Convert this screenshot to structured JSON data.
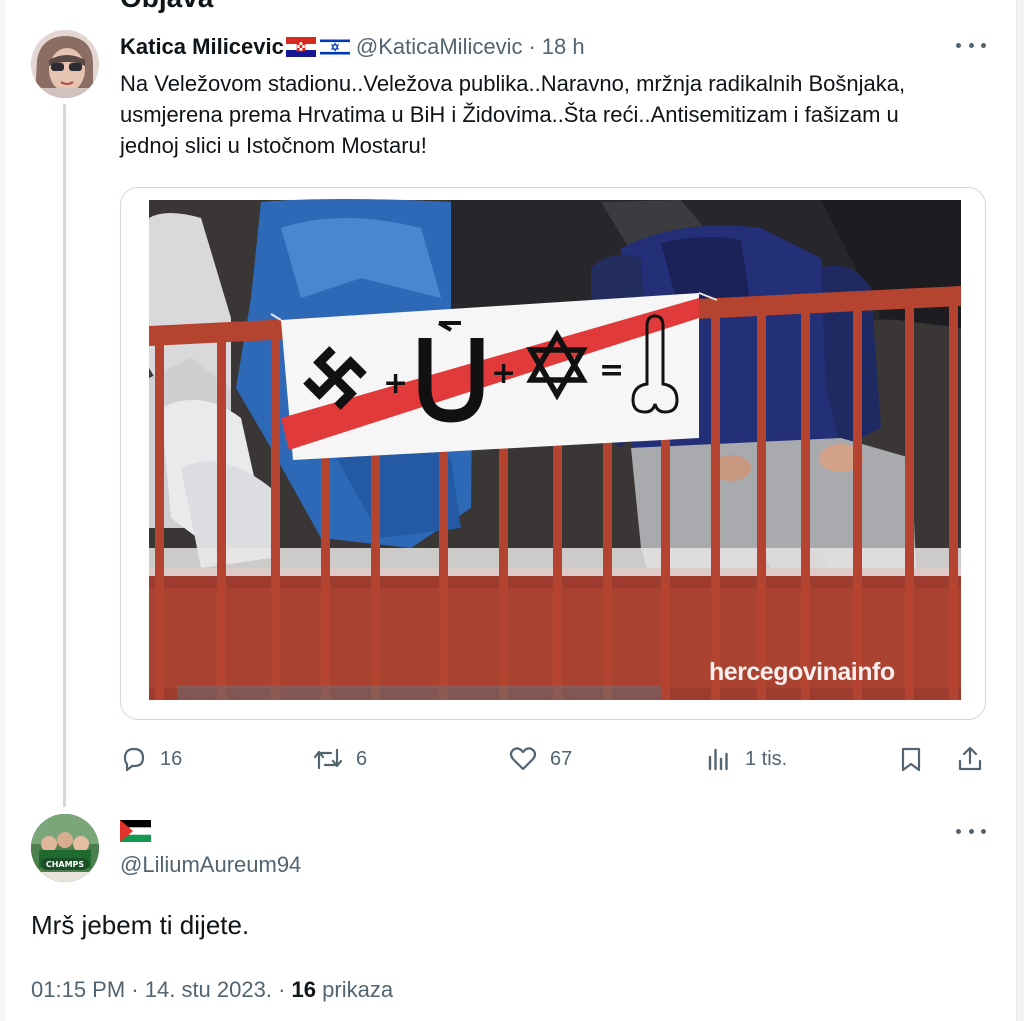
{
  "header": {
    "title": "Objava"
  },
  "parent_tweet": {
    "author_name": "Katica Milicevic",
    "flags": [
      "croatia-flag",
      "israel-flag"
    ],
    "handle": "@KaticaMilicevic",
    "separator": "·",
    "time": "18 h",
    "text": "Na Veležovom stadionu..Veležova publika..Naravno, mržnja radikalnih Bošnjaka, usmjerena prema Hrvatima u BiH i Židovima..Šta reći..Antisemitizam i fašizam u jednoj slici u Istočnom Mostaru!",
    "media": {
      "watermark": "hercegovinainfo",
      "banner_equation": [
        "+",
        "+",
        "="
      ]
    },
    "actions": {
      "replies": "16",
      "reposts": "6",
      "likes": "67",
      "views": "1 tis."
    }
  },
  "reply": {
    "flag": "palestine-flag",
    "handle": "@LiliumAureum94",
    "avatar_text": "CHAMPS",
    "text": "Mrš jebem ti dijete.",
    "meta": {
      "time": "01:15 PM",
      "separator": "·",
      "date": "14. stu 2023.",
      "separator2": "·",
      "view_count": "16",
      "view_label": "prikaza"
    }
  },
  "colors": {
    "text": "#0f1419",
    "secondary": "#536471",
    "border": "#cfd9de",
    "railing": "#b4432f"
  }
}
